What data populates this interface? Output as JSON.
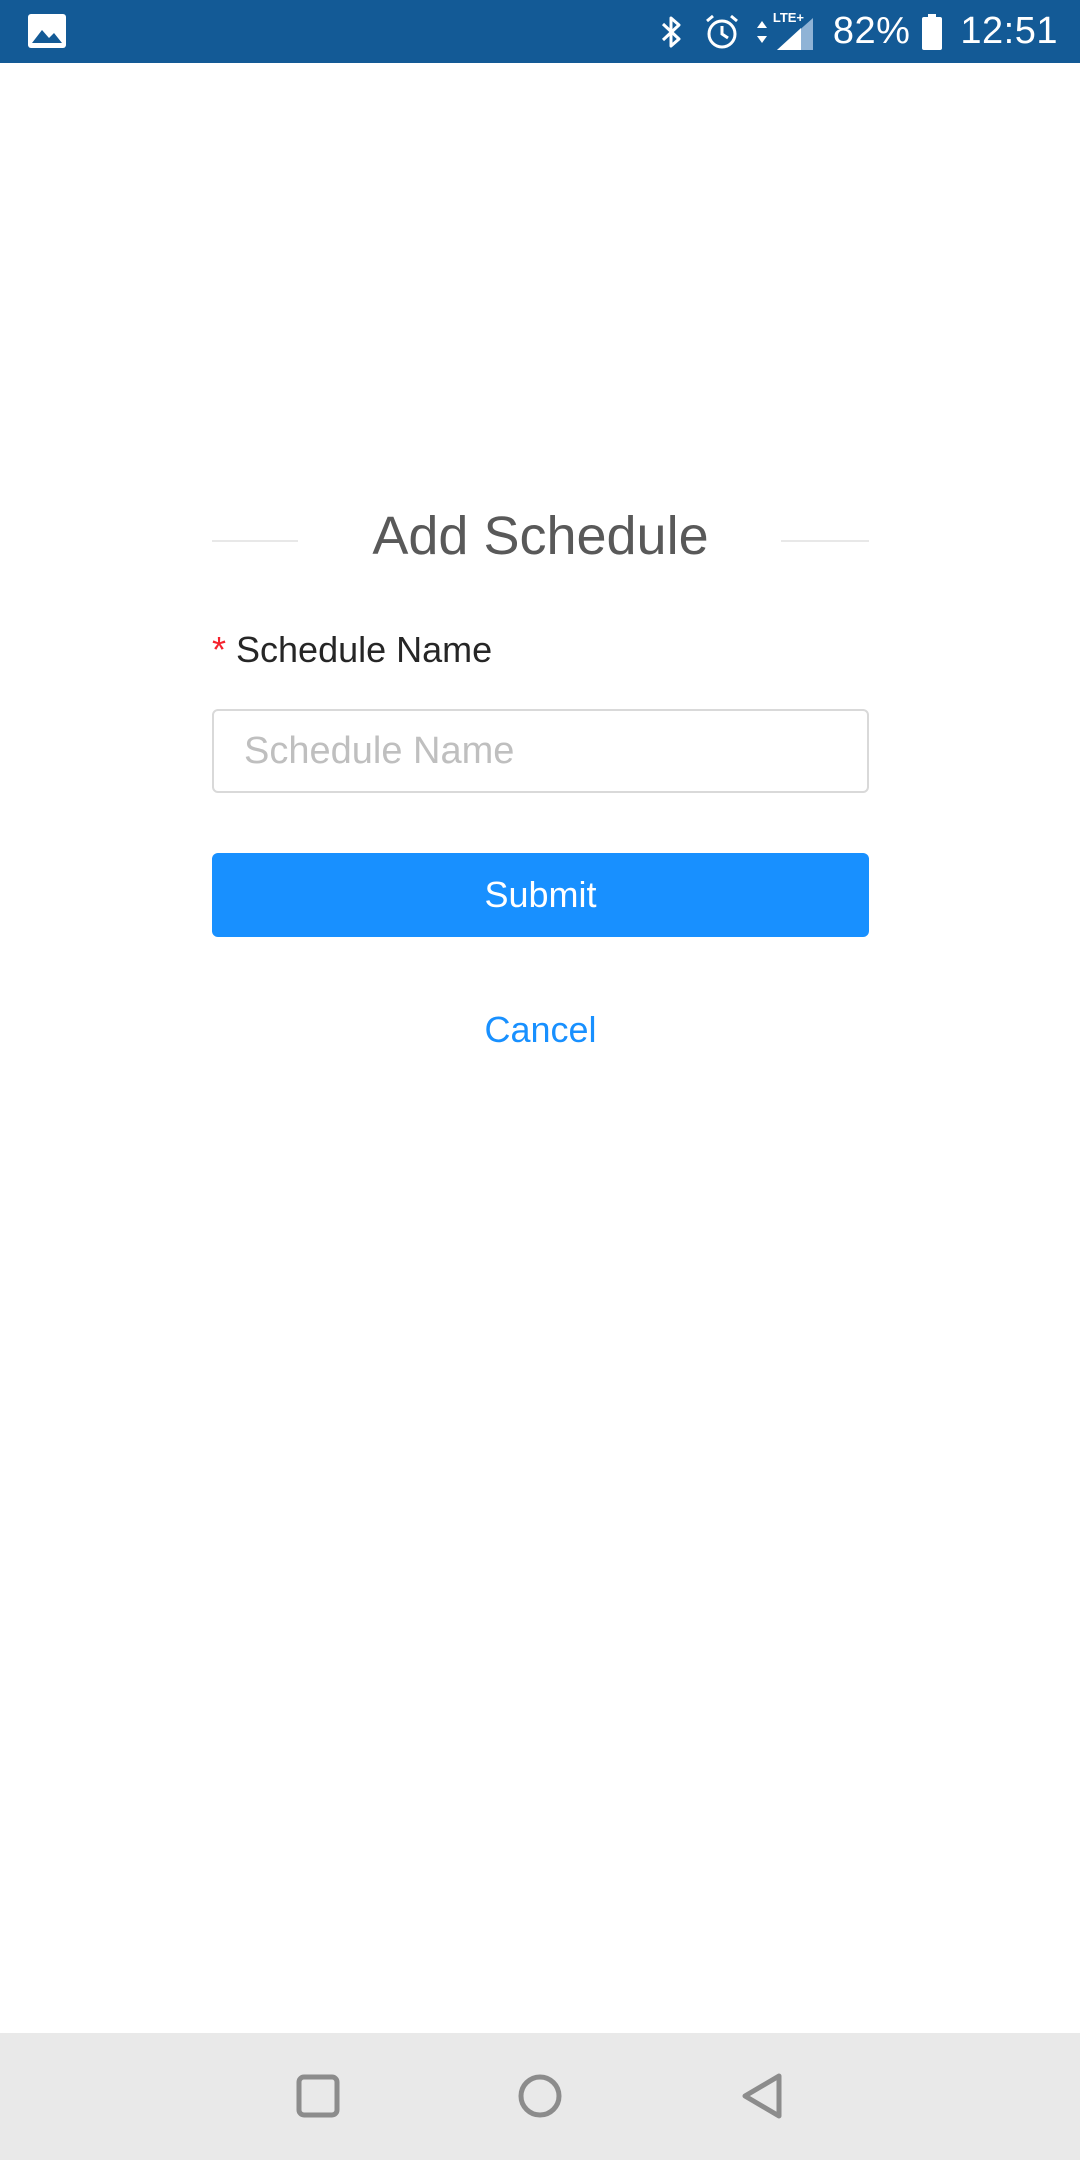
{
  "status_bar": {
    "battery_percent": "82%",
    "time": "12:51",
    "network_type": "LTE+",
    "icons": {
      "left": "gallery-icon",
      "right": [
        "bluetooth-icon",
        "alarm-icon",
        "data-arrows-icon",
        "signal-icon",
        "battery-icon"
      ]
    },
    "background_color": "#135a96"
  },
  "form": {
    "title": "Add Schedule",
    "fields": [
      {
        "label": "Schedule Name",
        "required_mark": "*",
        "placeholder": "Schedule Name",
        "value": ""
      }
    ],
    "submit_label": "Submit",
    "cancel_label": "Cancel"
  },
  "nav_bar": {
    "icons": [
      "recents-icon",
      "home-icon",
      "back-icon"
    ]
  },
  "colors": {
    "primary": "#1890ff",
    "required": "#f5222d",
    "title_text": "#595959",
    "label_text": "#262626",
    "placeholder_text": "#bfbfbf"
  }
}
